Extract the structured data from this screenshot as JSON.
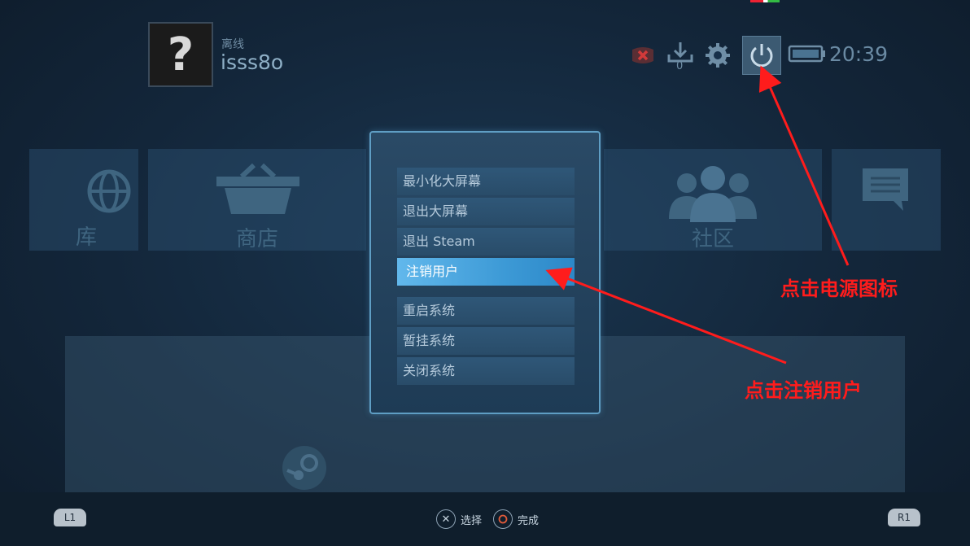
{
  "header": {
    "avatar_symbol": "?",
    "status": "离线",
    "username": "isss8o",
    "download_count": "0",
    "clock": "20:39"
  },
  "background_tiles": {
    "library_label": "库",
    "store_label": "商店",
    "community_label": "社区"
  },
  "power_menu": {
    "items": [
      {
        "label": "最小化大屏幕"
      },
      {
        "label": "退出大屏幕"
      },
      {
        "label": "退出 Steam"
      },
      {
        "label": "注销用户",
        "selected": true
      },
      {
        "label": "重启系统"
      },
      {
        "label": "暂挂系统"
      },
      {
        "label": "关闭系统"
      }
    ]
  },
  "footer": {
    "left_shoulder": "L1",
    "right_shoulder": "R1",
    "select_glyph": "✕",
    "select_label": "选择",
    "done_label": "完成"
  },
  "annotations": {
    "power_hint": "点击电源图标",
    "logout_hint": "点击注销用户",
    "color": "#ff1c1c"
  },
  "icons": [
    "no-controller-icon",
    "download-icon",
    "gear-icon",
    "power-icon",
    "battery-icon",
    "globe-icon",
    "basket-icon",
    "people-icon",
    "chat-icon",
    "steam-logo-icon",
    "cross-button-icon",
    "circle-button-icon"
  ]
}
